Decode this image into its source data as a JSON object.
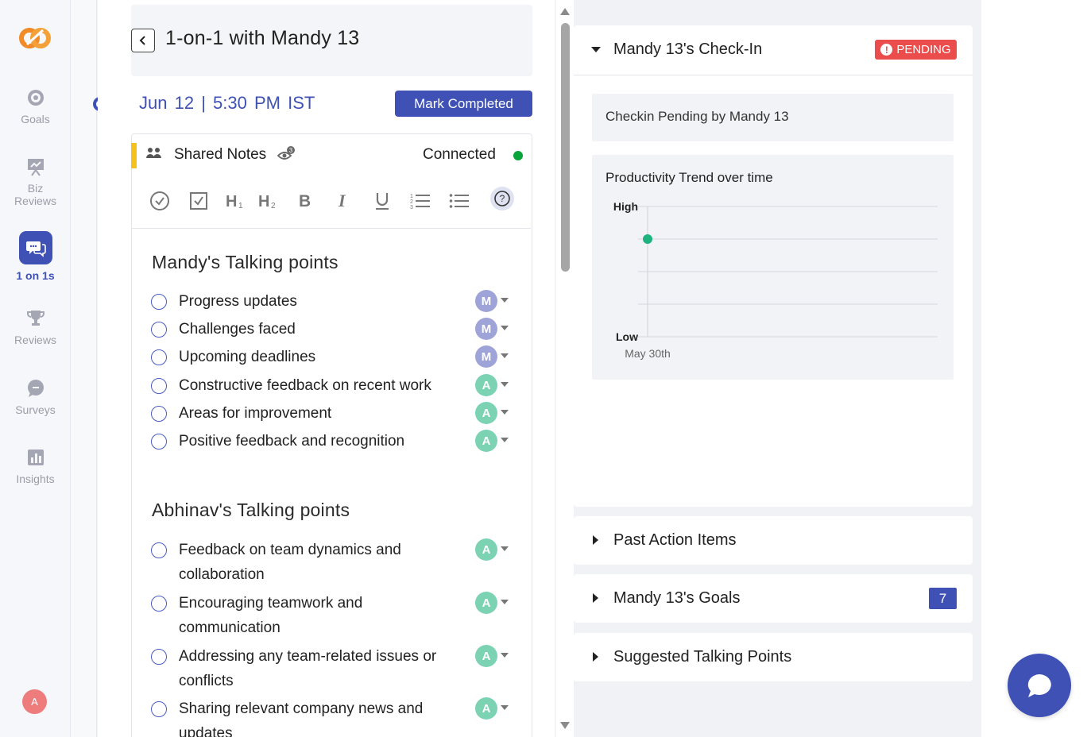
{
  "nav": {
    "items": [
      {
        "label": "Goals",
        "icon": "target-icon"
      },
      {
        "label": "Biz Reviews",
        "icon": "presentation-icon"
      },
      {
        "label": "1 on 1s",
        "icon": "chat-bubbles-icon"
      },
      {
        "label": "Reviews",
        "icon": "trophy-icon"
      },
      {
        "label": "Surveys",
        "icon": "survey-bubble-icon"
      },
      {
        "label": "Insights",
        "icon": "bar-chart-icon"
      }
    ],
    "active": "1 on 1s",
    "user_initial": "A"
  },
  "header": {
    "title": "1-on-1 with Mandy 13",
    "date": "Jun 12",
    "time": "5:30 PM",
    "timezone": "IST",
    "separator": "|",
    "mark_completed": "Mark Completed"
  },
  "notes": {
    "title": "Shared Notes",
    "viewer_count": "3",
    "connection_status": "Connected",
    "toolbar": [
      "check-circle",
      "checkbox",
      "heading-1",
      "heading-2",
      "bold",
      "italic",
      "underline",
      "numbered-list",
      "bullet-list",
      "help"
    ]
  },
  "mandy_points": {
    "title": "Mandy's Talking points",
    "items": [
      {
        "text": "Progress updates",
        "owner": "M"
      },
      {
        "text": "Challenges faced",
        "owner": "M"
      },
      {
        "text": "Upcoming deadlines",
        "owner": "M"
      },
      {
        "text": "Constructive feedback on recent work",
        "owner": "A"
      },
      {
        "text": "Areas for improvement",
        "owner": "A"
      },
      {
        "text": "Positive feedback and recognition",
        "owner": "A"
      }
    ]
  },
  "abhinav_points": {
    "title": "Abhinav's Talking points",
    "items": [
      {
        "text": "Feedback on team dynamics and collaboration",
        "owner": "A"
      },
      {
        "text": "Encouraging teamwork and communication",
        "owner": "A"
      },
      {
        "text": "Addressing any team-related issues or conflicts",
        "owner": "A"
      },
      {
        "text": "Sharing relevant company news and updates",
        "owner": "A"
      }
    ]
  },
  "checkin": {
    "title": "Mandy 13's Check-In",
    "status": "PENDING",
    "pending_message": "Checkin Pending by Mandy 13",
    "trend_title": "Productivity Trend over time"
  },
  "chart_data": {
    "type": "scatter",
    "title": "Productivity Trend over time",
    "y_categories": [
      "Low",
      "",
      "",
      "",
      "High"
    ],
    "y_tick_labels": [
      "High",
      "Low"
    ],
    "x": [
      "May 30th"
    ],
    "values": [
      4
    ],
    "ylim": [
      1,
      5
    ],
    "grid": true,
    "point_color": "#1db37e"
  },
  "panels": {
    "past_action_items": "Past Action Items",
    "goals": "Mandy 13's Goals",
    "goals_count": "7",
    "suggested": "Suggested Talking Points"
  },
  "colors": {
    "brand": "#3f51b5",
    "pending": "#eb4c4c",
    "connected": "#0aa53a",
    "accent_yellow": "#f4c21b",
    "avatar_m": "#9ea4d7",
    "avatar_a": "#7bd3b4"
  }
}
